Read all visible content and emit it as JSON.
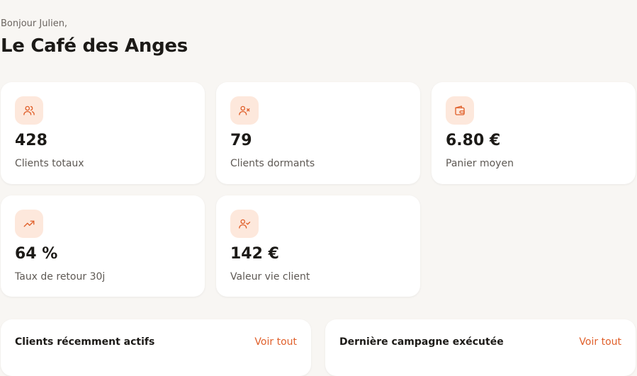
{
  "header": {
    "greeting": "Bonjour Julien,",
    "title": "Le Café des Anges"
  },
  "stats": [
    {
      "value": "428",
      "label": "Clients totaux",
      "icon": "users-icon"
    },
    {
      "value": "79",
      "label": "Clients dormants",
      "icon": "user-x-icon"
    },
    {
      "value": "6.80 €",
      "label": "Panier moyen",
      "icon": "wallet-icon"
    },
    {
      "value": "64 %",
      "label": "Taux de retour 30j",
      "icon": "trending-up-icon"
    },
    {
      "value": "142 €",
      "label": "Valeur vie client",
      "icon": "user-check-icon"
    }
  ],
  "panels": {
    "recent_clients": {
      "title": "Clients récemment actifs",
      "link": "Voir tout"
    },
    "last_campaign": {
      "title": "Dernière campagne exécutée",
      "link": "Voir tout"
    }
  },
  "colors": {
    "accent": "#e0602b",
    "icon_bg": "#fde8dc",
    "page_bg": "#f8f6f3"
  }
}
